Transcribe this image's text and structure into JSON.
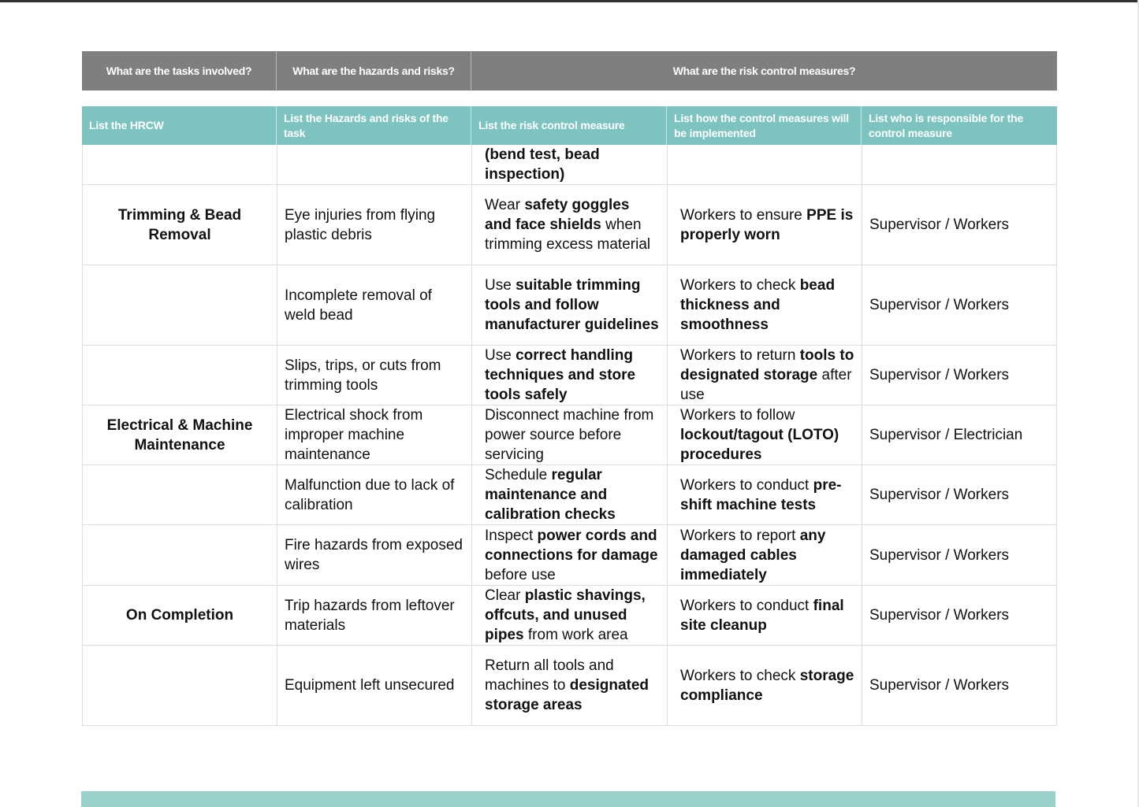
{
  "header_top": [
    "What are the tasks involved?",
    "What are the hazards and risks?",
    "What are the risk control measures?"
  ],
  "header_sub": [
    "List the HRCW",
    "List the Hazards and risks of the task",
    "List the risk control measure",
    "List how the control measures will be implemented",
    "List who is responsible for the control measure"
  ],
  "rows": [
    {
      "task": "",
      "hazard": "",
      "control": [
        {
          "t": "(bend test, bead inspection)",
          "b": true
        }
      ],
      "implement": [],
      "responsible": ""
    },
    {
      "task": "Trimming & Bead Removal",
      "hazard": "Eye injuries from flying plastic debris",
      "control": [
        {
          "t": "Wear ",
          "b": false
        },
        {
          "t": "safety goggles and face shields",
          "b": true
        },
        {
          "t": " when trimming excess material",
          "b": false
        }
      ],
      "implement": [
        {
          "t": "Workers to ensure ",
          "b": false
        },
        {
          "t": "PPE is properly worn",
          "b": true
        }
      ],
      "responsible": "Supervisor / Workers"
    },
    {
      "task": "",
      "hazard": "Incomplete removal of weld bead",
      "control": [
        {
          "t": "Use ",
          "b": false
        },
        {
          "t": "suitable trimming tools and follow manufacturer guidelines",
          "b": true
        }
      ],
      "implement": [
        {
          "t": "Workers to check ",
          "b": false
        },
        {
          "t": "bead thickness and smoothness",
          "b": true
        }
      ],
      "responsible": "Supervisor / Workers"
    },
    {
      "task": "",
      "hazard": "Slips, trips, or cuts from trimming tools",
      "control": [
        {
          "t": "Use ",
          "b": false
        },
        {
          "t": "correct handling techniques and store tools safely",
          "b": true
        }
      ],
      "implement": [
        {
          "t": "Workers to return ",
          "b": false
        },
        {
          "t": "tools to designated storage",
          "b": true
        },
        {
          "t": " after use",
          "b": false
        }
      ],
      "responsible": "Supervisor / Workers"
    },
    {
      "task": "Electrical & Machine Maintenance",
      "hazard": "Electrical shock from improper machine maintenance",
      "control": [
        {
          "t": "Disconnect machine from power source before servicing",
          "b": false
        }
      ],
      "implement": [
        {
          "t": "Workers to follow ",
          "b": false
        },
        {
          "t": "lockout/tagout (LOTO) procedures",
          "b": true
        }
      ],
      "responsible": "Supervisor / Electrician"
    },
    {
      "task": "",
      "hazard": "Malfunction due to lack of calibration",
      "control": [
        {
          "t": "Schedule ",
          "b": false
        },
        {
          "t": "regular maintenance and calibration checks",
          "b": true
        }
      ],
      "implement": [
        {
          "t": "Workers to conduct ",
          "b": false
        },
        {
          "t": "pre-shift machine tests",
          "b": true
        }
      ],
      "responsible": "Supervisor / Workers"
    },
    {
      "task": "",
      "hazard": "Fire hazards from exposed wires",
      "control": [
        {
          "t": "Inspect ",
          "b": false
        },
        {
          "t": "power cords and connections for damage",
          "b": true
        },
        {
          "t": " before use",
          "b": false
        }
      ],
      "implement": [
        {
          "t": "Workers to report ",
          "b": false
        },
        {
          "t": "any damaged cables immediately",
          "b": true
        }
      ],
      "responsible": "Supervisor / Workers"
    },
    {
      "task": "On Completion",
      "hazard": "Trip hazards from leftover materials",
      "control": [
        {
          "t": "Clear ",
          "b": false
        },
        {
          "t": "plastic shavings, offcuts, and unused pipes",
          "b": true
        },
        {
          "t": " from work area",
          "b": false
        }
      ],
      "implement": [
        {
          "t": "Workers to conduct ",
          "b": false
        },
        {
          "t": "final site cleanup",
          "b": true
        }
      ],
      "responsible": "Supervisor / Workers"
    },
    {
      "task": "",
      "hazard": "Equipment left unsecured",
      "control": [
        {
          "t": "Return all tools and machines to ",
          "b": false
        },
        {
          "t": "designated storage areas",
          "b": true
        }
      ],
      "implement": [
        {
          "t": "Workers to check ",
          "b": false
        },
        {
          "t": "storage compliance",
          "b": true
        }
      ],
      "responsible": "Supervisor / Workers"
    }
  ]
}
